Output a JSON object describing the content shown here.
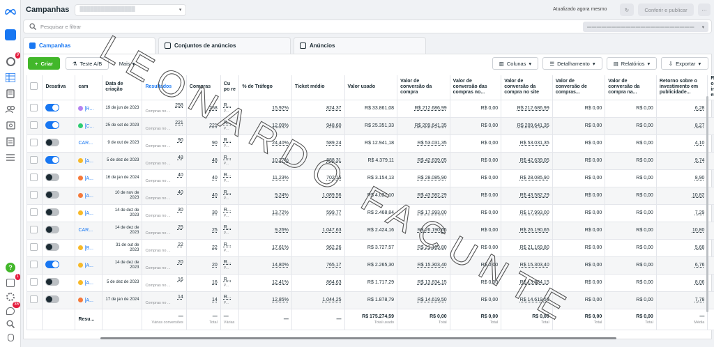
{
  "header": {
    "title": "Campanhas",
    "updated": "Atualizado agora mesmo",
    "publish": "Conferir e publicar",
    "more": "⋯"
  },
  "search": {
    "placeholder": "Pesquisar e filtrar"
  },
  "tabs": [
    {
      "label": "Campanhas"
    },
    {
      "label": "Conjuntos de anúncios"
    },
    {
      "label": "Anúncios"
    }
  ],
  "toolbar": {
    "create": "Criar",
    "ab_test": "Teste A/B",
    "more": "Mais",
    "columns": "Colunas",
    "breakdown": "Detalhamento",
    "reports": "Relatórios",
    "export": "Exportar"
  },
  "rail_badges": {
    "notif": "9",
    "alerts": "1",
    "messages": "35"
  },
  "columns": [
    "Desativa",
    "cam",
    "Data de criação",
    "Resultados",
    "Compras",
    "Cu po re",
    "% de Tráfego",
    "Ticket médio",
    "Valor usado",
    "Valor de conversão da compra",
    "Valor de conversão das compras no...",
    "Valor de conversão da compra no site",
    "Valor de conversão de compras...",
    "Valor de conversão da compra na...",
    "Retorno sobre o investimento em publicidade...",
    "Reto o in em"
  ],
  "rows": [
    {
      "on": true,
      "icon": "#b583f0",
      "name": "[R...",
      "date": "19 de jun de 2023",
      "results": "258",
      "purch": "258",
      "cu": "R...",
      "traffic": "15,92%",
      "ticket": "824,37",
      "spent": "R$ 33.861,08",
      "conv": "R$ 212.686,99",
      "c2": "R$ 0,00",
      "c3": "R$ 212.686,99",
      "c4": "R$ 0,00",
      "c5": "R$ 0,00",
      "roas": "6,28"
    },
    {
      "on": true,
      "icon": "#2ecc71",
      "name": "[C...",
      "date": "25 de set de 2023",
      "results": "221",
      "purch": "221",
      "cu": "R...",
      "traffic": "12,09%",
      "ticket": "948,60",
      "spent": "R$ 25.351,33",
      "conv": "R$ 209.641,35",
      "c2": "R$ 0,00",
      "c3": "R$ 209.641,35",
      "c4": "R$ 0,00",
      "c5": "R$ 0,00",
      "roas": "8,27"
    },
    {
      "on": false,
      "icon": "",
      "name": "CAR...",
      "date": "9 de out de 2023",
      "results": "90",
      "purch": "90",
      "cu": "R...",
      "traffic": "24,40%",
      "ticket": "589,24",
      "spent": "R$ 12.941,18",
      "conv": "R$ 53.031,35",
      "c2": "R$ 0,00",
      "c3": "R$ 53.031,35",
      "c4": "R$ 0,00",
      "c5": "R$ 0,00",
      "roas": "4,10"
    },
    {
      "on": true,
      "icon": "#f7b928",
      "name": "[A...",
      "date": "5 de dez de 2023",
      "results": "48",
      "purch": "48",
      "cu": "R...",
      "traffic": "10,27%",
      "ticket": "888,31",
      "spent": "R$ 4.379,11",
      "conv": "R$ 42.639,05",
      "c2": "R$ 0,00",
      "c3": "R$ 42.639,05",
      "c4": "R$ 0,00",
      "c5": "R$ 0,00",
      "roas": "9,74"
    },
    {
      "on": false,
      "icon": "#f5793a",
      "name": "[A...",
      "date": "16 de jan de 2024",
      "results": "40",
      "purch": "40",
      "cu": "R...",
      "traffic": "11,23%",
      "ticket": "702,15",
      "spent": "R$ 3.154,13",
      "conv": "R$ 28.085,90",
      "c2": "R$ 0,00",
      "c3": "R$ 28.085,90",
      "c4": "R$ 0,00",
      "c5": "R$ 0,00",
      "roas": "8,90"
    },
    {
      "on": false,
      "icon": "#f5793a",
      "name": "[A...",
      "date": "10 de nov de 2023",
      "results": "40",
      "purch": "40",
      "cu": "R...",
      "traffic": "9,24%",
      "ticket": "1.089,56",
      "spent": "R$ 4.027,10",
      "conv": "R$ 43.582,29",
      "c2": "R$ 0,00",
      "c3": "R$ 43.582,29",
      "c4": "R$ 0,00",
      "c5": "R$ 0,00",
      "roas": "10,82"
    },
    {
      "on": false,
      "icon": "#f7b928",
      "name": "[A...",
      "date": "14 de dez de 2023",
      "results": "30",
      "purch": "30",
      "cu": "R...",
      "traffic": "13,72%",
      "ticket": "599,77",
      "spent": "R$ 2.468,84",
      "conv": "R$ 17.993,00",
      "c2": "R$ 0,00",
      "c3": "R$ 17.993,00",
      "c4": "R$ 0,00",
      "c5": "R$ 0,00",
      "roas": "7,29"
    },
    {
      "on": false,
      "icon": "",
      "name": "CAR...",
      "date": "14 de dez de 2023",
      "results": "25",
      "purch": "25",
      "cu": "R...",
      "traffic": "9,26%",
      "ticket": "1.047,63",
      "spent": "R$ 2.424,16",
      "conv": "R$ 26.190,65",
      "c2": "R$ 0,00",
      "c3": "R$ 26.190,65",
      "c4": "R$ 0,00",
      "c5": "R$ 0,00",
      "roas": "10,80"
    },
    {
      "on": false,
      "icon": "#f7b928",
      "name": "[B...",
      "date": "31 de out de 2023",
      "results": "22",
      "purch": "22",
      "cu": "R...",
      "traffic": "17,61%",
      "ticket": "962,26",
      "spent": "R$ 3.727,57",
      "conv": "R$ 21.169,80",
      "c2": "R$ 0,00",
      "c3": "R$ 21.169,80",
      "c4": "R$ 0,00",
      "c5": "R$ 0,00",
      "roas": "5,68"
    },
    {
      "on": true,
      "icon": "#f7b928",
      "name": "[A...",
      "date": "14 de dez de 2023",
      "results": "20",
      "purch": "20",
      "cu": "R...",
      "traffic": "14,80%",
      "ticket": "765,17",
      "spent": "R$ 2.265,30",
      "conv": "R$ 15.303,40",
      "c2": "R$ 0,00",
      "c3": "R$ 15.303,40",
      "c4": "R$ 0,00",
      "c5": "R$ 0,00",
      "roas": "6,76"
    },
    {
      "on": false,
      "icon": "#f7b928",
      "name": "[A...",
      "date": "5 de dez de 2023",
      "results": "16",
      "purch": "16",
      "cu": "R...",
      "traffic": "12,41%",
      "ticket": "864,63",
      "spent": "R$ 1.717,29",
      "conv": "R$ 13.834,15",
      "c2": "R$ 0,00",
      "c3": "R$ 13.834,15",
      "c4": "R$ 0,00",
      "c5": "R$ 0,00",
      "roas": "8,06"
    },
    {
      "on": false,
      "icon": "#f5793a",
      "name": "[A...",
      "date": "17 de jan de 2024",
      "results": "14",
      "purch": "14",
      "cu": "R...",
      "traffic": "12,85%",
      "ticket": "1.044,25",
      "spent": "R$ 1.878,79",
      "conv": "R$ 14.619,50",
      "c2": "R$ 0,00",
      "c3": "R$ 14.619,50",
      "c4": "R$ 0,00",
      "c5": "R$ 0,00",
      "roas": "7,78"
    }
  ],
  "row_sub": "Compras no ...",
  "row_sub_cu": "P...",
  "footer": {
    "label": "Resu...",
    "results": "—",
    "results_sub": "Várias conversões",
    "purch": "—",
    "purch_sub": "Total",
    "cu": "—",
    "cu_sub": "Várias",
    "traffic": "—",
    "ticket": "—",
    "spent": "R$ 175.274,59",
    "spent_sub": "Total usado",
    "conv": "R$ 0,00",
    "conv_sub": "Total",
    "c2": "R$ 0,00",
    "c2_sub": "Total",
    "c3": "R$ 0,00",
    "c3_sub": "Total",
    "c4": "R$ 0,00",
    "c4_sub": "Total",
    "c5": "R$ 0,00",
    "c5_sub": "Total",
    "roas": "—",
    "roas_sub": "Média"
  },
  "watermark": "LEONARDO FACUNTE"
}
